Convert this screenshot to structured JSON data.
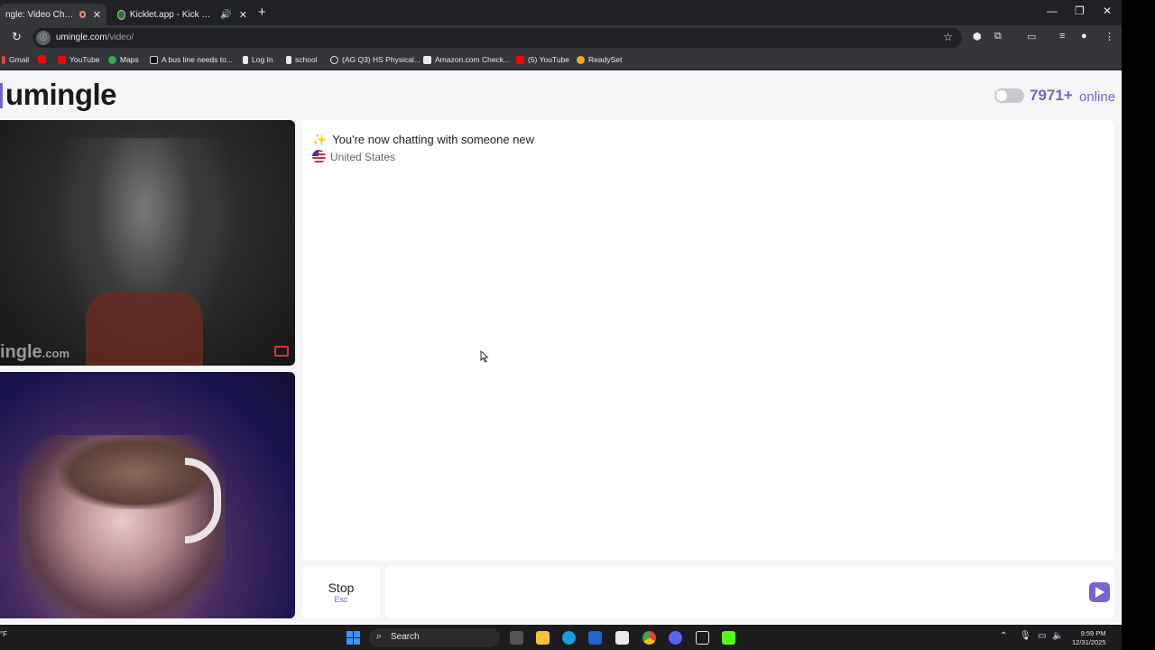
{
  "browser": {
    "tabs": [
      {
        "title": "ngle: Video Chat with S"
      },
      {
        "title": "Kicklet.app - Kick Chatbot a"
      }
    ],
    "url_host": "umingle.com",
    "url_path": "/video/",
    "bookmarks": [
      {
        "label": "Gmail"
      },
      {
        "label": ""
      },
      {
        "label": "YouTube"
      },
      {
        "label": "Maps"
      },
      {
        "label": "A bus line needs to..."
      },
      {
        "label": "Log In"
      },
      {
        "label": "school"
      },
      {
        "label": "(AG Q3) HS Physical..."
      },
      {
        "label": "Amazon.com Check..."
      },
      {
        "label": "(5) YouTube"
      },
      {
        "label": "ReadySet"
      }
    ]
  },
  "site": {
    "logo": "umingle",
    "online_count": "7971+",
    "online_label": "online",
    "watermark": "ingle",
    "watermark_suffix": ".com"
  },
  "chat": {
    "status_message": "You're now chatting with someone new",
    "country": "United States",
    "stop_label": "Stop",
    "stop_hint": "Esc",
    "input_placeholder": ""
  },
  "taskbar": {
    "search_label": "Search",
    "temp": "°F",
    "time": "9:59 PM",
    "date": "12/31/2025"
  },
  "colors": {
    "brand": "#7b61d1",
    "chrome_dark": "#202124",
    "chrome_toolbar": "#35363a"
  }
}
